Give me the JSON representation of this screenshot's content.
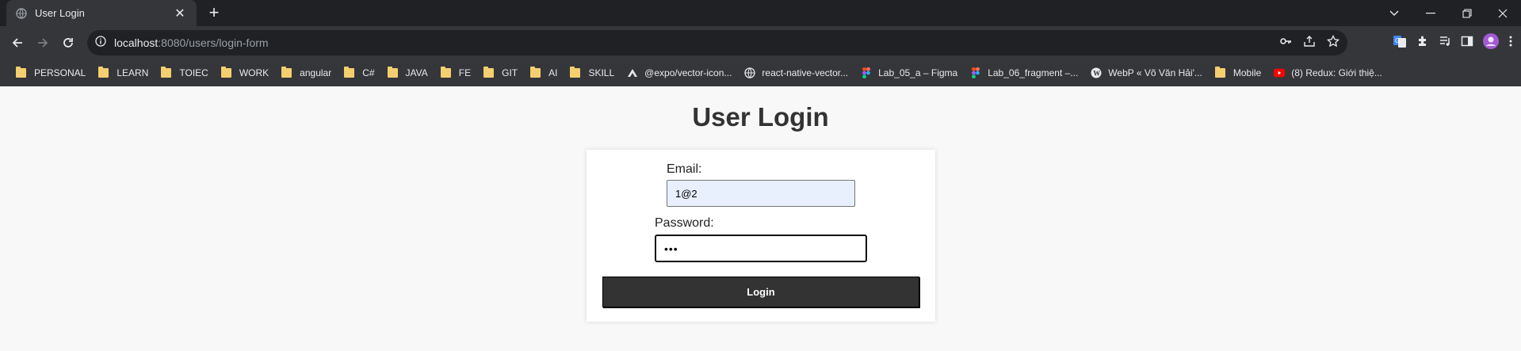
{
  "browser": {
    "tab": {
      "title": "User Login",
      "close": "✕"
    },
    "new_tab": "+",
    "address": {
      "host": "localhost",
      "rest": ":8080/users/login-form"
    }
  },
  "bookmarks": [
    {
      "label": "PERSONAL",
      "icon": "folder-icon"
    },
    {
      "label": "LEARN",
      "icon": "folder-icon"
    },
    {
      "label": "TOIEC",
      "icon": "folder-icon"
    },
    {
      "label": "WORK",
      "icon": "folder-icon"
    },
    {
      "label": "angular",
      "icon": "folder-icon"
    },
    {
      "label": "C#",
      "icon": "folder-icon"
    },
    {
      "label": "JAVA",
      "icon": "folder-icon"
    },
    {
      "label": "FE",
      "icon": "folder-icon"
    },
    {
      "label": "GIT",
      "icon": "folder-icon"
    },
    {
      "label": "AI",
      "icon": "folder-icon"
    },
    {
      "label": "SKILL",
      "icon": "folder-icon"
    },
    {
      "label": "@expo/vector-icon...",
      "icon": "expo-icon"
    },
    {
      "label": "react-native-vector...",
      "icon": "globe-icon"
    },
    {
      "label": "Lab_05_a – Figma",
      "icon": "figma-icon"
    },
    {
      "label": "Lab_06_fragment –...",
      "icon": "figma-icon"
    },
    {
      "label": "WebP « Võ Văn Hải'...",
      "icon": "wordpress-icon"
    },
    {
      "label": "Mobile",
      "icon": "folder-icon"
    },
    {
      "label": "(8) Redux: Giới thiệ...",
      "icon": "youtube-icon"
    }
  ],
  "page": {
    "title": "User Login",
    "email_label": "Email:",
    "email_value": "1@2",
    "password_label": "Password:",
    "password_mask": "•••",
    "login_label": "Login"
  },
  "colors": {
    "tabstrip": "#202124",
    "toolbar": "#35363a",
    "page_bg": "#f8f8f8",
    "button_bg": "#333333",
    "autofill_bg": "#e8f0fe"
  }
}
